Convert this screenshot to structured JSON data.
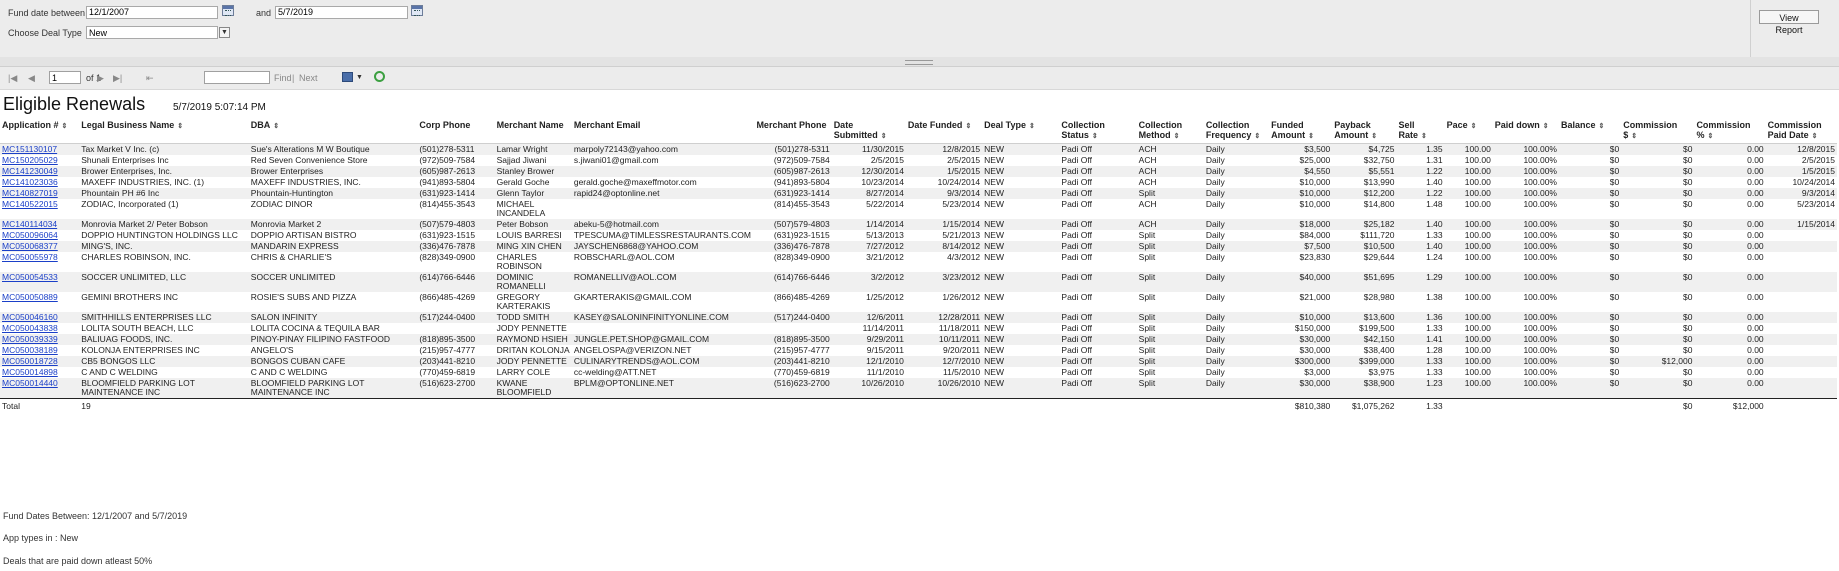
{
  "params": {
    "fund_date_label": "Fund date between",
    "fund_date_from": "12/1/2007",
    "and_label": "and",
    "fund_date_to": "5/7/2019",
    "deal_type_label": "Choose Deal Type",
    "deal_type_value": "New",
    "view_report": "View Report"
  },
  "toolbar": {
    "first_icon": "|◀",
    "prev_icon": "◀",
    "page": "1",
    "of": "of 1",
    "next_icon": "▶",
    "last_icon": "▶|",
    "back_icon": "⇤",
    "find": "Find",
    "sep": "|",
    "next": "Next"
  },
  "report": {
    "title": "Eligible Renewals",
    "timestamp": "5/7/2019 5:07:14 PM"
  },
  "columns": [
    {
      "label": "Application #",
      "sort": true
    },
    {
      "label": "Legal Business Name",
      "sort": true
    },
    {
      "label": "DBA",
      "sort": true
    },
    {
      "label": "Corp Phone",
      "sort": false
    },
    {
      "label": "Merchant Name",
      "sort": false
    },
    {
      "label": "Merchant Email",
      "sort": false
    },
    {
      "label": "Merchant Phone",
      "sort": false
    },
    {
      "label": "Date Submitted",
      "sort": true
    },
    {
      "label": "Date Funded",
      "sort": true
    },
    {
      "label": "Deal Type",
      "sort": true
    },
    {
      "label": "Collection Status",
      "sort": true
    },
    {
      "label": "Collection Method",
      "sort": true
    },
    {
      "label": "Collection Frequency",
      "sort": true
    },
    {
      "label": "Funded Amount",
      "sort": true
    },
    {
      "label": "Payback Amount",
      "sort": true
    },
    {
      "label": "Sell Rate",
      "sort": true
    },
    {
      "label": "Pace",
      "sort": true
    },
    {
      "label": "Paid down",
      "sort": true
    },
    {
      "label": "Balance",
      "sort": true
    },
    {
      "label": "Commission $",
      "sort": true
    },
    {
      "label": "Commission %",
      "sort": true
    },
    {
      "label": "Commission Paid Date",
      "sort": true
    }
  ],
  "rows": [
    [
      "MC151130107",
      "Tax Market V Inc. (c)",
      "Sue's Alterations M W Boutique",
      "(501)278-5311",
      "Lamar Wright",
      "marpoly72143@yahoo.com",
      "(501)278-5311",
      "11/30/2015",
      "12/8/2015",
      "NEW",
      "Padi Off",
      "ACH",
      "Daily",
      "$3,500",
      "$4,725",
      "1.35",
      "100.00",
      "100.00%",
      "$0",
      "$0",
      "0.00",
      "12/8/2015"
    ],
    [
      "MC150205029",
      "Shunali Enterprises Inc",
      "Red Seven Convenience Store",
      "(972)509-7584",
      "Sajjad Jiwani",
      "s.jiwani01@gmail.com",
      "(972)509-7584",
      "2/5/2015",
      "2/5/2015",
      "NEW",
      "Padi Off",
      "ACH",
      "Daily",
      "$25,000",
      "$32,750",
      "1.31",
      "100.00",
      "100.00%",
      "$0",
      "$0",
      "0.00",
      "2/5/2015"
    ],
    [
      "MC141230049",
      "Brower Enterprises, Inc.",
      "Brower Enterprises",
      "(605)987-2613",
      "Stanley Brower",
      "",
      "(605)987-2613",
      "12/30/2014",
      "1/5/2015",
      "NEW",
      "Padi Off",
      "ACH",
      "Daily",
      "$4,550",
      "$5,551",
      "1.22",
      "100.00",
      "100.00%",
      "$0",
      "$0",
      "0.00",
      "1/5/2015"
    ],
    [
      "MC141023036",
      "MAXEFF INDUSTRIES, INC. (1)",
      "MAXEFF INDUSTRIES, INC.",
      "(941)893-5804",
      "Gerald Goche",
      "gerald.goche@maxeffmotor.com",
      "(941)893-5804",
      "10/23/2014",
      "10/24/2014",
      "NEW",
      "Padi Off",
      "ACH",
      "Daily",
      "$10,000",
      "$13,990",
      "1.40",
      "100.00",
      "100.00%",
      "$0",
      "$0",
      "0.00",
      "10/24/2014"
    ],
    [
      "MC140827019",
      "Phountain PH #6 Inc",
      "Phountain-Huntington",
      "(631)923-1414",
      "Glenn Taylor",
      "rapid24@optonline.net",
      "(631)923-1414",
      "8/27/2014",
      "9/3/2014",
      "NEW",
      "Padi Off",
      "Split",
      "Daily",
      "$10,000",
      "$12,200",
      "1.22",
      "100.00",
      "100.00%",
      "$0",
      "$0",
      "0.00",
      "9/3/2014"
    ],
    [
      "MC140522015",
      "ZODIAC, Incorporated (1)",
      "ZODIAC DINOR",
      "(814)455-3543",
      "MICHAEL INCANDELA",
      "",
      "(814)455-3543",
      "5/22/2014",
      "5/23/2014",
      "NEW",
      "Padi Off",
      "ACH",
      "Daily",
      "$10,000",
      "$14,800",
      "1.48",
      "100.00",
      "100.00%",
      "$0",
      "$0",
      "0.00",
      "5/23/2014"
    ],
    [
      "MC140114034",
      "Monrovia Market 2/ Peter Bobson",
      "Monrovia Market 2",
      "(507)579-4803",
      "Peter Bobson",
      "abeku-5@hotmail.com",
      "(507)579-4803",
      "1/14/2014",
      "1/15/2014",
      "NEW",
      "Padi Off",
      "ACH",
      "Daily",
      "$18,000",
      "$25,182",
      "1.40",
      "100.00",
      "100.00%",
      "$0",
      "$0",
      "0.00",
      "1/15/2014"
    ],
    [
      "MC050096064",
      "DOPPIO HUNTINGTON HOLDINGS LLC",
      "DOPPIO ARTISAN BISTRO",
      "(631)923-1515",
      "LOUIS BARRESI",
      "TPESCUMA@TIMLESSRESTAURANTS.COM",
      "(631)923-1515",
      "5/13/2013",
      "5/21/2013",
      "NEW",
      "Padi Off",
      "Split",
      "Daily",
      "$84,000",
      "$111,720",
      "1.33",
      "100.00",
      "100.00%",
      "$0",
      "$0",
      "0.00",
      ""
    ],
    [
      "MC050068377",
      "MING'S, INC.",
      "MANDARIN EXPRESS",
      "(336)476-7878",
      "MING XIN CHEN",
      "JAYSCHEN6868@YAHOO.COM",
      "(336)476-7878",
      "7/27/2012",
      "8/14/2012",
      "NEW",
      "Padi Off",
      "Split",
      "Daily",
      "$7,500",
      "$10,500",
      "1.40",
      "100.00",
      "100.00%",
      "$0",
      "$0",
      "0.00",
      ""
    ],
    [
      "MC050055978",
      "CHARLES ROBINSON, INC.",
      "CHRIS & CHARLIE'S",
      "(828)349-0900",
      "CHARLES ROBINSON",
      "ROBSCHARL@AOL.COM",
      "(828)349-0900",
      "3/21/2012",
      "4/3/2012",
      "NEW",
      "Padi Off",
      "Split",
      "Daily",
      "$23,830",
      "$29,644",
      "1.24",
      "100.00",
      "100.00%",
      "$0",
      "$0",
      "0.00",
      ""
    ],
    [
      "MC050054533",
      "SOCCER UNLIMITED, LLC",
      "SOCCER UNLIMITED",
      "(614)766-6446",
      "DOMINIC ROMANELLI",
      "ROMANELLIV@AOL.COM",
      "(614)766-6446",
      "3/2/2012",
      "3/23/2012",
      "NEW",
      "Padi Off",
      "Split",
      "Daily",
      "$40,000",
      "$51,695",
      "1.29",
      "100.00",
      "100.00%",
      "$0",
      "$0",
      "0.00",
      ""
    ],
    [
      "MC050050889",
      "GEMINI BROTHERS INC",
      "ROSIE'S SUBS AND PIZZA",
      "(866)485-4269",
      "GREGORY KARTERAKIS",
      "GKARTERAKIS@GMAIL.COM",
      "(866)485-4269",
      "1/25/2012",
      "1/26/2012",
      "NEW",
      "Padi Off",
      "Split",
      "Daily",
      "$21,000",
      "$28,980",
      "1.38",
      "100.00",
      "100.00%",
      "$0",
      "$0",
      "0.00",
      ""
    ],
    [
      "MC050046160",
      "SMITHHILLS ENTERPRISES LLC",
      "SALON INFINITY",
      "(517)244-0400",
      "TODD SMITH",
      "KASEY@SALONINFINITYONLINE.COM",
      "(517)244-0400",
      "12/6/2011",
      "12/28/2011",
      "NEW",
      "Padi Off",
      "Split",
      "Daily",
      "$10,000",
      "$13,600",
      "1.36",
      "100.00",
      "100.00%",
      "$0",
      "$0",
      "0.00",
      ""
    ],
    [
      "MC050043838",
      "LOLITA SOUTH BEACH, LLC",
      "LOLITA COCINA & TEQUILA BAR",
      "",
      "JODY PENNETTE",
      "",
      "",
      "11/14/2011",
      "11/18/2011",
      "NEW",
      "Padi Off",
      "Split",
      "Daily",
      "$150,000",
      "$199,500",
      "1.33",
      "100.00",
      "100.00%",
      "$0",
      "$0",
      "0.00",
      ""
    ],
    [
      "MC050039339",
      "BALIUAG FOODS, INC.",
      "PINOY-PINAY FILIPINO FASTFOOD",
      "(818)895-3500",
      "RAYMOND HSIEH",
      "JUNGLE.PET.SHOP@GMAIL.COM",
      "(818)895-3500",
      "9/29/2011",
      "10/11/2011",
      "NEW",
      "Padi Off",
      "Split",
      "Daily",
      "$30,000",
      "$42,150",
      "1.41",
      "100.00",
      "100.00%",
      "$0",
      "$0",
      "0.00",
      ""
    ],
    [
      "MC050038189",
      "KOLONJA ENTERPRISES INC",
      "ANGELO'S",
      "(215)957-4777",
      "DRITAN KOLONJA",
      "ANGELOSPA@VERIZON.NET",
      "(215)957-4777",
      "9/15/2011",
      "9/20/2011",
      "NEW",
      "Padi Off",
      "Split",
      "Daily",
      "$30,000",
      "$38,400",
      "1.28",
      "100.00",
      "100.00%",
      "$0",
      "$0",
      "0.00",
      ""
    ],
    [
      "MC050018728",
      "CB5 BONGOS LLC",
      "BONGOS CUBAN CAFE",
      "(203)441-8210",
      "JODY PENNETTE",
      "CULINARYTRENDS@AOL.COM",
      "(203)441-8210",
      "12/1/2010",
      "12/7/2010",
      "NEW",
      "Padi Off",
      "Split",
      "Daily",
      "$300,000",
      "$399,000",
      "1.33",
      "100.00",
      "100.00%",
      "$0",
      "$12,000",
      "0.00",
      ""
    ],
    [
      "MC050014898",
      "C AND C WELDING",
      "C AND C WELDING",
      "(770)459-6819",
      "LARRY COLE",
      "cc-welding@ATT.NET",
      "(770)459-6819",
      "11/1/2010",
      "11/5/2010",
      "NEW",
      "Padi Off",
      "Split",
      "Daily",
      "$3,000",
      "$3,975",
      "1.33",
      "100.00",
      "100.00%",
      "$0",
      "$0",
      "0.00",
      ""
    ],
    [
      "MC050014440",
      "BLOOMFIELD PARKING LOT MAINTENANCE INC",
      "BLOOMFIELD PARKING LOT MAINTENANCE INC",
      "(516)623-2700",
      "KWANE BLOOMFIELD",
      "BPLM@OPTONLINE.NET",
      "(516)623-2700",
      "10/26/2010",
      "10/26/2010",
      "NEW",
      "Padi Off",
      "Split",
      "Daily",
      "$30,000",
      "$38,900",
      "1.23",
      "100.00",
      "100.00%",
      "$0",
      "$0",
      "0.00",
      ""
    ]
  ],
  "totals": {
    "label": "Total",
    "count": "19",
    "funded": "$810,380",
    "payback": "$1,075,262",
    "sell_rate": "1.33",
    "commission": "$0",
    "commission_pct": "$12,000"
  },
  "footer": {
    "line1": "Fund Dates Between: 12/1/2007 and 5/7/2019",
    "line2": "App types in : New",
    "line3": "Deals that are paid down atleast 50%"
  }
}
